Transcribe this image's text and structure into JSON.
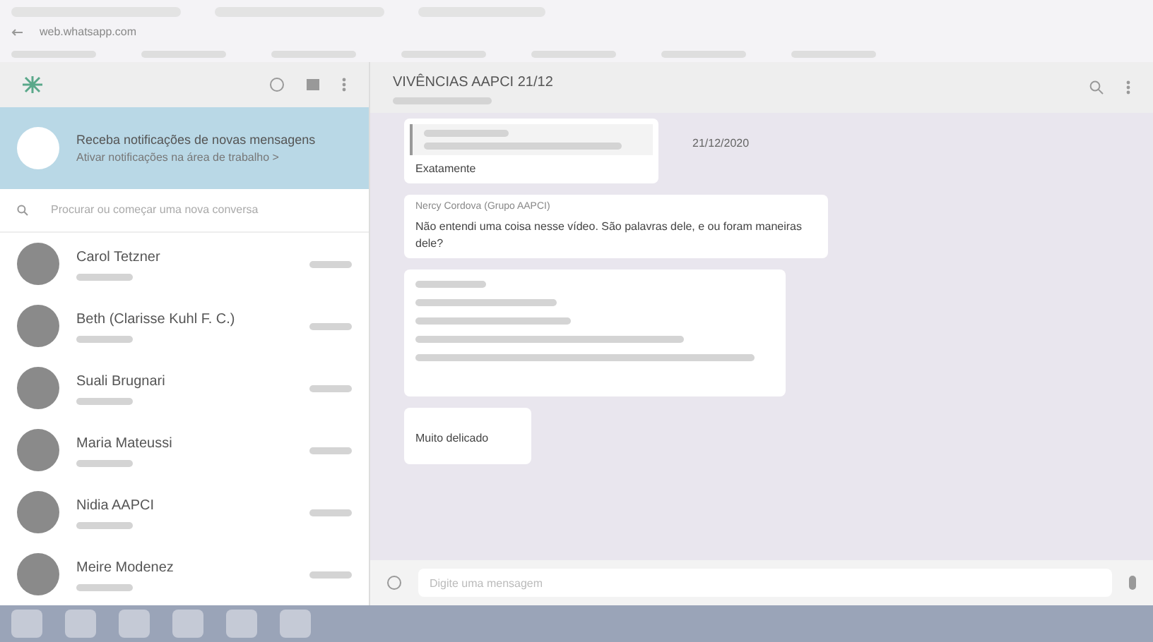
{
  "browser": {
    "address": "web.whatsapp.com"
  },
  "notification": {
    "title": "Receba notificações de novas mensagens",
    "link": "Ativar notificações na área de trabalho >"
  },
  "search": {
    "placeholder": "Procurar ou começar uma nova conversa"
  },
  "chats": [
    {
      "name": "Carol Tetzner"
    },
    {
      "name": "Beth (Clarisse Kuhl F. C.)"
    },
    {
      "name": "Suali Brugnari"
    },
    {
      "name": "Maria Mateussi"
    },
    {
      "name": "Nidia AAPCI"
    },
    {
      "name": "Meire Modenez"
    }
  ],
  "conversation": {
    "title": "VIVÊNCIAS AAPCI 21/12",
    "date": "21/12/2020"
  },
  "messages": [
    {
      "kind": "quote",
      "text": "Exatamente"
    },
    {
      "kind": "sender",
      "sender": "Nercy Cordova (Grupo AAPCI)",
      "text": "Não entendi uma coisa nesse vídeo. São palavras dele, e ou foram maneiras dele?"
    },
    {
      "kind": "forwarded"
    },
    {
      "kind": "plain",
      "text": "Muito delicado"
    }
  ],
  "composer": {
    "placeholder": "Digite uma mensagem"
  }
}
